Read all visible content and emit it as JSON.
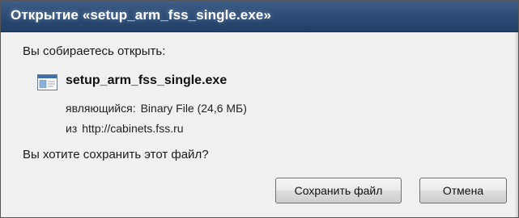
{
  "dialog": {
    "title": "Открытие «setup_arm_fss_single.exe»",
    "prompt": "Вы собираетесь открыть:",
    "file_name": "setup_arm_fss_single.exe",
    "type_label": "являющийся:",
    "type_value": "Binary File (24,6 МБ)",
    "from_label": "из",
    "from_value": "http://cabinets.fss.ru",
    "question": "Вы хотите сохранить этот файл?",
    "file_icon": "executable-file-icon"
  },
  "buttons": {
    "save_label": "Сохранить файл",
    "cancel_label": "Отмена"
  },
  "colors": {
    "titlebar": "#2a4a74",
    "title_text": "#ffffff",
    "window_bg": "#f0f0f0"
  }
}
